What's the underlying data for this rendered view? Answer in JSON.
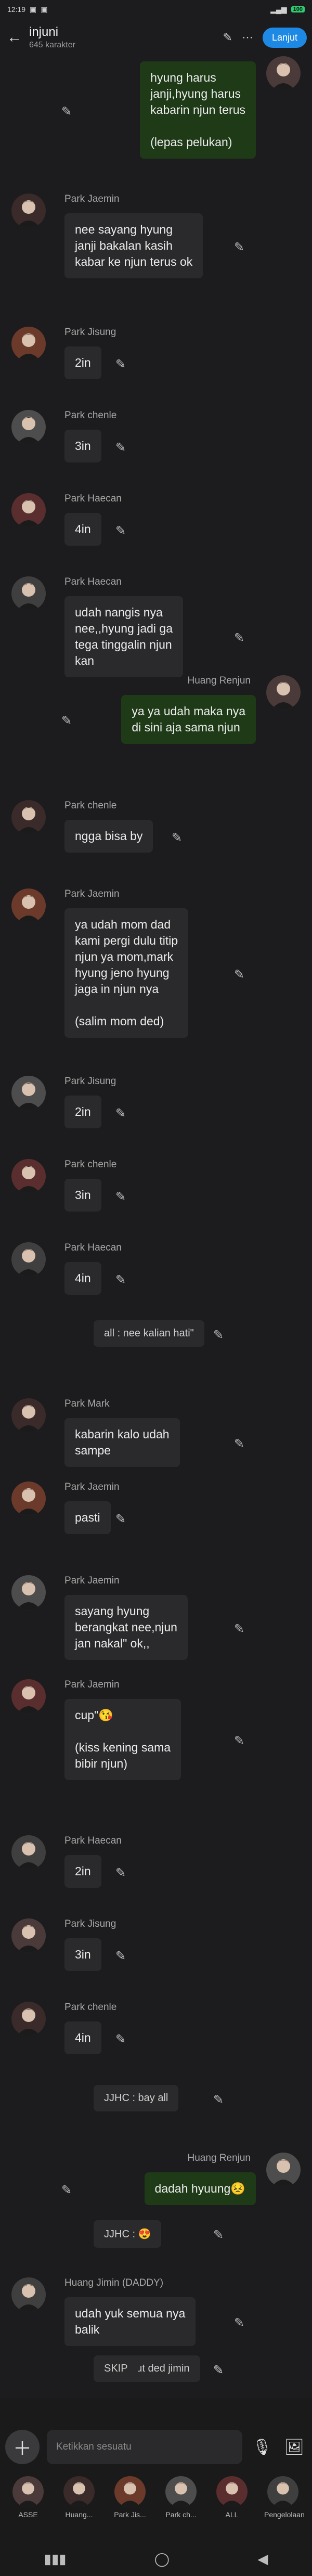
{
  "status": {
    "time": "12:19",
    "battery": "100"
  },
  "header": {
    "title": "injuni",
    "subtitle": "645 karakter",
    "next_label": "Lanjut"
  },
  "messages": [
    {
      "type": "right",
      "name": "",
      "text": "hyung harus\njanji,hyung harus\nkabarin njun terus\n\n(lepas pelukan)"
    },
    {
      "type": "left",
      "name": "Park Jaemin",
      "text": "nee sayang hyung\njanji bakalan kasih\nkabar ke njun terus ok"
    },
    {
      "type": "left",
      "name": "Park Jisung",
      "text": "2in"
    },
    {
      "type": "left",
      "name": "Park chenle",
      "text": "3in"
    },
    {
      "type": "left",
      "name": "Park Haecan",
      "text": "4in"
    },
    {
      "type": "left",
      "name": "Park Haecan",
      "text": "udah nangis nya\nnee,,hyung jadi ga\ntega tinggalin njun\nkan"
    },
    {
      "type": "right",
      "name": "Huang Renjun",
      "text": "ya ya udah maka nya\ndi sini aja sama njun"
    },
    {
      "type": "left",
      "name": "Park chenle",
      "text": "ngga bisa by"
    },
    {
      "type": "left",
      "name": "Park Jaemin",
      "text": "ya udah mom dad\nkami pergi dulu titip\nnjun ya mom,mark\nhyung jeno hyung\njaga in njun nya\n\n(salim mom ded)"
    },
    {
      "type": "left",
      "name": "Park Jisung",
      "text": "2in"
    },
    {
      "type": "left",
      "name": "Park chenle",
      "text": "3in"
    },
    {
      "type": "left",
      "name": "Park Haecan",
      "text": "4in"
    },
    {
      "type": "system",
      "text": "all : nee kalian hati\""
    },
    {
      "type": "left",
      "name": "Park Mark",
      "text": "kabarin kalo udah\nsampe"
    },
    {
      "type": "left",
      "name": "Park Jaemin",
      "text": "pasti"
    },
    {
      "type": "left",
      "name": "Park Jaemin",
      "text": "sayang hyung\nberangkat nee,njun\njan nakal\" ok,,"
    },
    {
      "type": "left",
      "name": "Park Jaemin",
      "text": "cup\"😘\n\n(kiss kening sama\nbibir njun)"
    },
    {
      "type": "left",
      "name": "Park Haecan",
      "text": "2in"
    },
    {
      "type": "left",
      "name": "Park Jisung",
      "text": "3in"
    },
    {
      "type": "left",
      "name": "Park chenle",
      "text": "4in"
    },
    {
      "type": "system",
      "text": "JJHC : bay all"
    },
    {
      "type": "right",
      "name": "Huang Renjun",
      "text": "dadah hyuung😣"
    },
    {
      "type": "system",
      "text": "JJHC : 😍"
    },
    {
      "type": "left",
      "name": "Huang Jimin (DADDY)",
      "text": "udah yuk semua nya\nbalik"
    },
    {
      "type": "system",
      "text": "all ngikut ded jimin"
    },
    {
      "type": "system",
      "text": "SKIP"
    }
  ],
  "composer": {
    "placeholder": "Ketikkan sesuatu"
  },
  "characters": [
    {
      "label": "ASSE"
    },
    {
      "label": "Huang..."
    },
    {
      "label": "Park Jis..."
    },
    {
      "label": "Park ch..."
    },
    {
      "label": "ALL"
    },
    {
      "label": "Pengelolaan"
    }
  ],
  "colors": {
    "accent": "#1e88e5",
    "right_bubble": "#1e3a17",
    "left_bubble": "#2a2a2c",
    "background": "#1c1c1e"
  }
}
